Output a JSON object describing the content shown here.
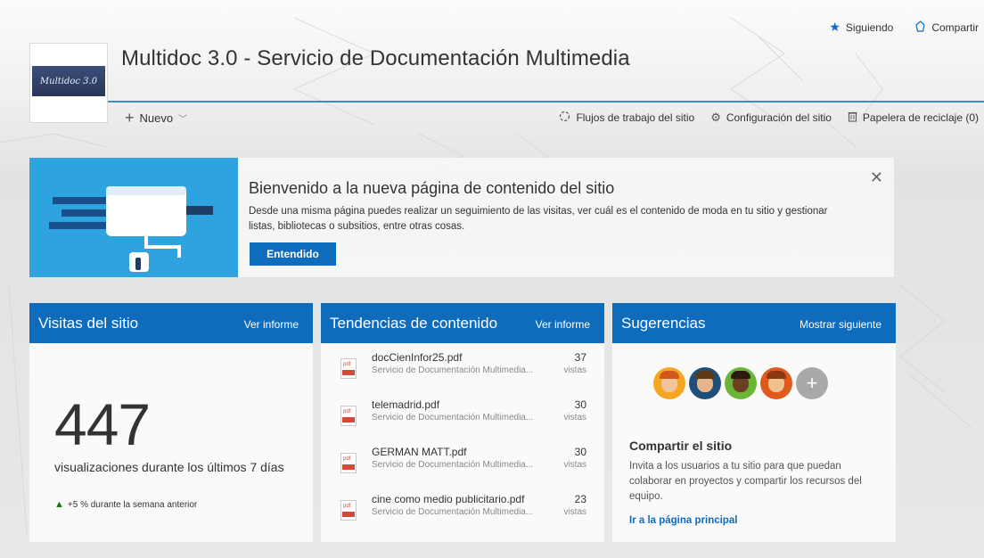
{
  "top_actions": {
    "following": "Siguiendo",
    "share": "Compartir"
  },
  "site": {
    "logo_text": "Multidoc 3.0",
    "title": "Multidoc 3.0 - Servicio de Documentación Multimedia"
  },
  "command_bar": {
    "new_label": "Nuevo",
    "workflows": "Flujos de trabajo del sitio",
    "settings": "Configuración del sitio",
    "recycle_bin": "Papelera de reciclaje (0)"
  },
  "banner": {
    "title": "Bienvenido a la nueva página de contenido del sitio",
    "text": "Desde una misma página puedes realizar un seguimiento de las visitas, ver cuál es el contenido de moda en tu sitio y gestionar listas, bibliotecas o subsitios, entre otras cosas.",
    "button": "Entendido"
  },
  "site_visits": {
    "title": "Visitas del sitio",
    "link": "Ver informe",
    "count": "447",
    "caption": "visualizaciones durante los últimos 7 días",
    "trend": "+5 % durante la semana anterior"
  },
  "content_trends": {
    "title": "Tendencias de contenido",
    "link": "Ver informe",
    "items": [
      {
        "name": "docCienInfor25.pdf",
        "source": "Servicio de Documentación Multimedia...",
        "count": "37",
        "unit": "vistas"
      },
      {
        "name": "telemadrid.pdf",
        "source": "Servicio de Documentación Multimedia...",
        "count": "30",
        "unit": "vistas"
      },
      {
        "name": "GERMAN MATT.pdf",
        "source": "Servicio de Documentación Multimedia...",
        "count": "30",
        "unit": "vistas"
      },
      {
        "name": "cine como medio publicitario.pdf",
        "source": "Servicio de Documentación Multimedia...",
        "count": "23",
        "unit": "vistas"
      }
    ]
  },
  "suggestions": {
    "title": "Sugerencias",
    "link": "Mostrar siguiente",
    "avatars": [
      {
        "bg": "#f5a623",
        "skin": "#f2c49b",
        "hair": "#d1571d"
      },
      {
        "bg": "#1f4e79",
        "skin": "#e8b58a",
        "hair": "#5a3a1a"
      },
      {
        "bg": "#6bb536",
        "skin": "#6b3f22",
        "hair": "#2a1a10"
      },
      {
        "bg": "#e05a1f",
        "skin": "#f0c08f",
        "hair": "#8a3a12"
      }
    ],
    "share_title": "Compartir el sitio",
    "share_text": "Invita a los usuarios a tu sitio para que puedan colaborar en proyectos y compartir los recursos del equipo.",
    "share_link": "Ir a la página principal"
  },
  "colors": {
    "accent": "#0f6cbd",
    "banner_art": "#2ea3e0",
    "trend_up": "#107c10"
  }
}
